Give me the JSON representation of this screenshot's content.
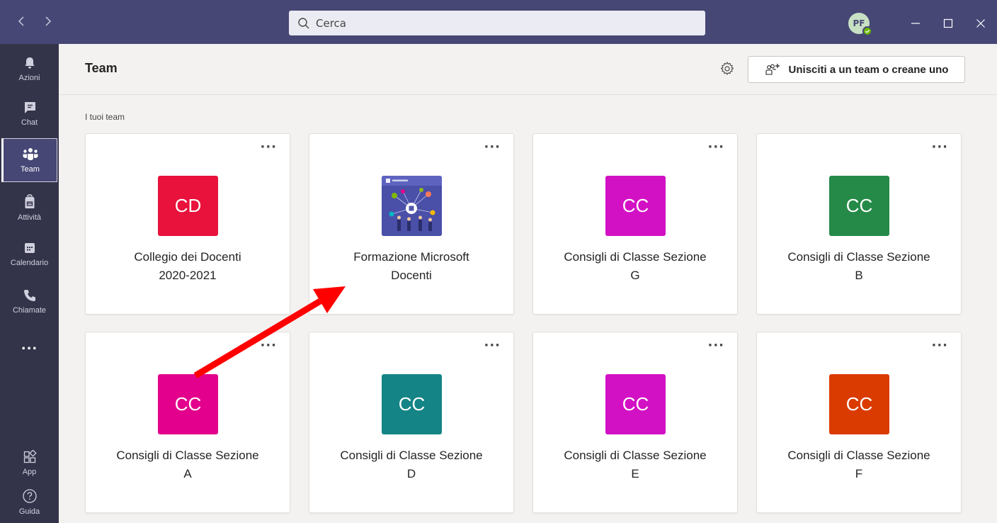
{
  "search": {
    "placeholder": "Cerca"
  },
  "user": {
    "initials": "PF",
    "status_color": "#6bb700"
  },
  "rail": {
    "items": [
      {
        "label": "Azioni",
        "icon": "bell-icon"
      },
      {
        "label": "Chat",
        "icon": "chat-icon"
      },
      {
        "label": "Team",
        "icon": "teams-icon",
        "active": true
      },
      {
        "label": "Attività",
        "icon": "backpack-icon"
      },
      {
        "label": "Calendario",
        "icon": "calendar-icon"
      },
      {
        "label": "Chiamate",
        "icon": "phone-icon"
      }
    ],
    "more": "...",
    "bottom": [
      {
        "label": "App",
        "icon": "apps-icon"
      },
      {
        "label": "Guida",
        "icon": "help-icon"
      }
    ]
  },
  "header": {
    "title": "Team",
    "join_label": "Unisciti a un team o creane uno"
  },
  "section_label": "I tuoi team",
  "teams": [
    {
      "initials": "CD",
      "color": "#e8123c",
      "line1": "Collegio dei Docenti",
      "line2": "2020-2021"
    },
    {
      "initials": "",
      "image": "microsoft-teams-image",
      "line1": "Formazione Microsoft",
      "line2": "Docenti"
    },
    {
      "initials": "CC",
      "color": "#d311c4",
      "line1": "Consigli di Classe Sezione",
      "line2": "G"
    },
    {
      "initials": "CC",
      "color": "#258a48",
      "line1": "Consigli di Classe Sezione",
      "line2": "B"
    },
    {
      "initials": "CC",
      "color": "#e3008c",
      "line1": "Consigli di Classe Sezione",
      "line2": "A"
    },
    {
      "initials": "CC",
      "color": "#158486",
      "line1": "Consigli di Classe Sezione",
      "line2": "D"
    },
    {
      "initials": "CC",
      "color": "#d311c4",
      "line1": "Consigli di Classe Sezione",
      "line2": "E"
    },
    {
      "initials": "CC",
      "color": "#da3b01",
      "line1": "Consigli di Classe Sezione",
      "line2": "F"
    }
  ],
  "more_glyph": "···",
  "annotation": {
    "arrow_color": "#ff0000"
  }
}
